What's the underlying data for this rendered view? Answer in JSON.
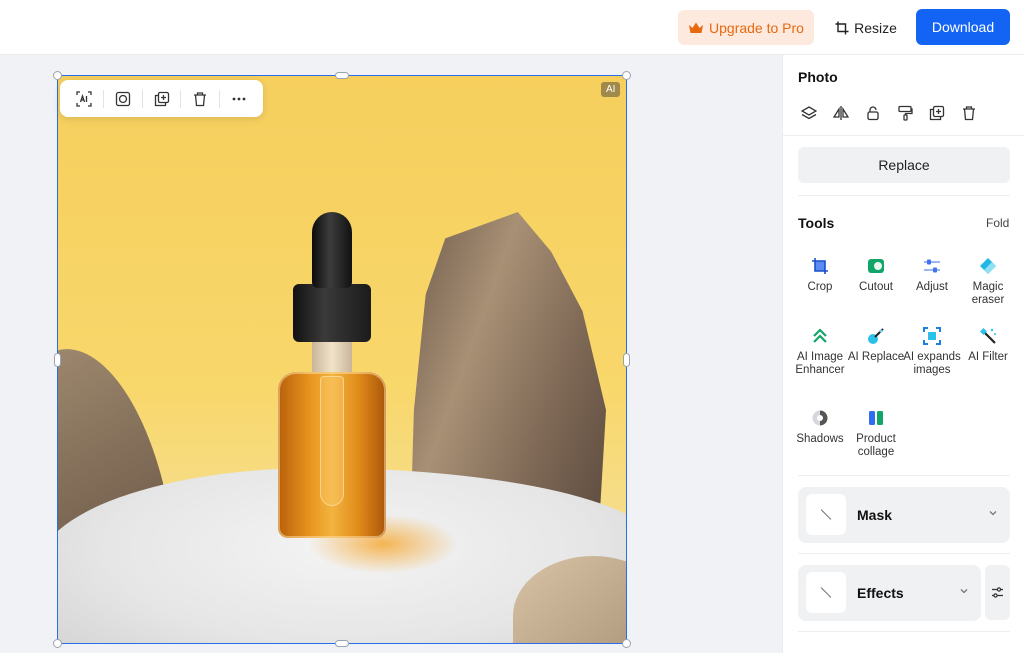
{
  "topbar": {
    "upgrade_label": "Upgrade to Pro",
    "resize_label": "Resize",
    "download_label": "Download",
    "upgrade_color": "#e8690f",
    "download_color": "#1364f5"
  },
  "canvas": {
    "ai_badge": "AI",
    "float_toolbar": [
      "ai-text-icon",
      "frame-icon",
      "duplicate-icon",
      "trash-icon",
      "more-icon"
    ]
  },
  "panel": {
    "title": "Photo",
    "photo_actions": [
      "layers-icon",
      "flip-icon",
      "lock-icon",
      "paint-roller-icon",
      "duplicate-icon",
      "trash-icon"
    ],
    "replace_label": "Replace",
    "tools_title": "Tools",
    "fold_label": "Fold",
    "tools": [
      {
        "label": "Crop",
        "icon": "crop-icon"
      },
      {
        "label": "Cutout",
        "icon": "cutout-icon"
      },
      {
        "label": "Adjust",
        "icon": "adjust-icon"
      },
      {
        "label": "Magic eraser",
        "icon": "magic-eraser-icon"
      },
      {
        "label": "AI Image Enhancer",
        "icon": "enhancer-icon"
      },
      {
        "label": "AI Replace",
        "icon": "ai-replace-icon"
      },
      {
        "label": "AI expands images",
        "icon": "expand-icon"
      },
      {
        "label": "AI Filter",
        "icon": "ai-filter-icon"
      },
      {
        "label": "Shadows",
        "icon": "shadows-icon"
      },
      {
        "label": "Product collage",
        "icon": "collage-icon"
      }
    ],
    "mask_label": "Mask",
    "effects_label": "Effects"
  }
}
